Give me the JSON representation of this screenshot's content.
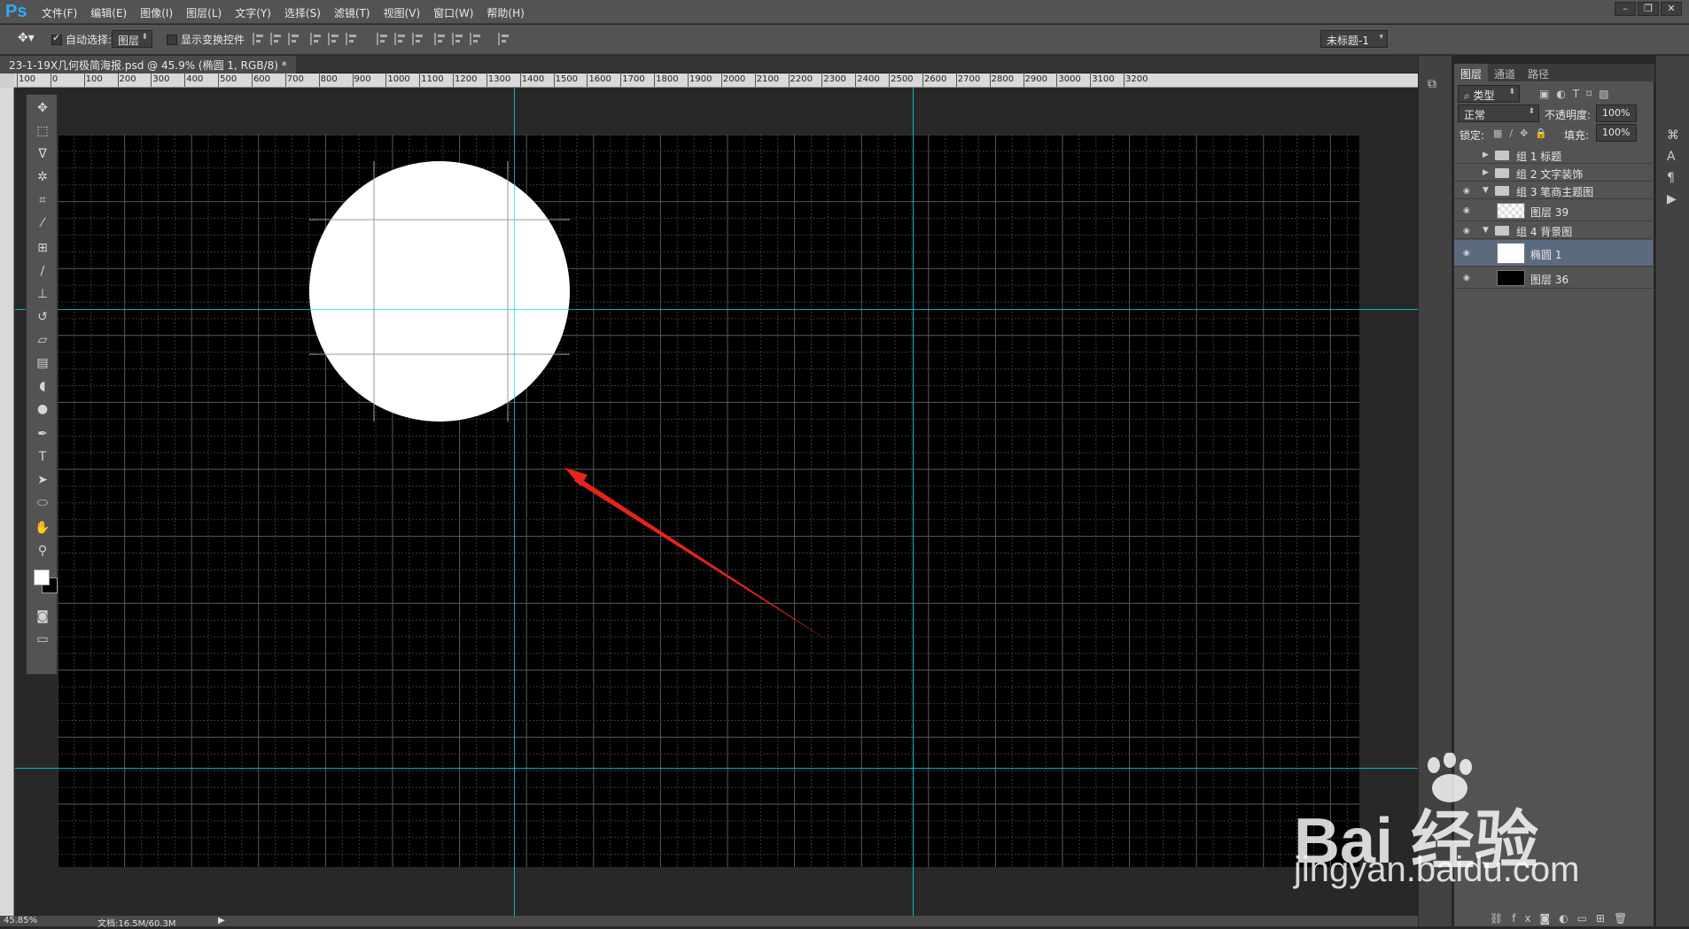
{
  "app": {
    "logo": "Ps",
    "menu": [
      "文件(F)",
      "编辑(E)",
      "图像(I)",
      "图层(L)",
      "文字(Y)",
      "选择(S)",
      "滤镜(T)",
      "视图(V)",
      "窗口(W)",
      "帮助(H)"
    ],
    "window_buttons": [
      "–",
      "❐",
      "✕"
    ]
  },
  "options": {
    "auto_select_label": "自动选择:",
    "auto_select_checked": true,
    "auto_select_target": "图层",
    "show_transform_label": "显示变换控件",
    "show_transform_checked": false,
    "workspace": "未标题-1"
  },
  "document": {
    "tab_title": "23-1-19X几何极简海报.psd @ 45.9% (椭圆 1, RGB/8) *",
    "zoom": "45.85%",
    "doc_size": "文档:16.5M/60.3M"
  },
  "ruler": {
    "labels": [
      "100",
      "0",
      "100",
      "200",
      "300",
      "400",
      "500",
      "600",
      "700",
      "800",
      "900",
      "1000",
      "1100",
      "1200",
      "1300",
      "1400",
      "1500",
      "1600",
      "1700",
      "1800",
      "1900",
      "2000",
      "2100",
      "2200",
      "2300",
      "2400",
      "2500",
      "2600",
      "2700",
      "2800",
      "2900",
      "3000",
      "3100",
      "3200"
    ]
  },
  "colors": {
    "guide": "#00e5ff",
    "arrow": "#e8231a",
    "circle": "#ffffff",
    "selected_layer": "#5c6a80"
  },
  "panel": {
    "tabs": [
      "图层",
      "通道",
      "路径"
    ],
    "filter_kind": "类型",
    "blend_mode": "正常",
    "opacity_label": "不透明度:",
    "opacity": "100%",
    "lock_label": "锁定:",
    "fill_label": "填充:",
    "fill": "100%",
    "layers": [
      {
        "name": "组 1 标题",
        "type": "group",
        "visible": false,
        "expanded": false,
        "indent": 0,
        "selected": false
      },
      {
        "name": "组 2 文字装饰",
        "type": "group",
        "visible": false,
        "expanded": false,
        "indent": 0,
        "selected": false
      },
      {
        "name": "组 3 笔商主题图",
        "type": "group",
        "visible": true,
        "expanded": true,
        "indent": 0,
        "selected": false
      },
      {
        "name": "图层 39",
        "type": "transparent",
        "visible": true,
        "indent": 1,
        "selected": false
      },
      {
        "name": "组 4 背景图",
        "type": "group",
        "visible": true,
        "expanded": true,
        "indent": 0,
        "selected": false
      },
      {
        "name": "椭圆 1",
        "type": "shape",
        "visible": true,
        "indent": 1,
        "selected": true
      },
      {
        "name": "图层 36",
        "type": "black",
        "visible": true,
        "indent": 1,
        "selected": false
      }
    ]
  },
  "watermark": {
    "brand": "Bai 经验",
    "url": "jingyan.baidu.com"
  }
}
